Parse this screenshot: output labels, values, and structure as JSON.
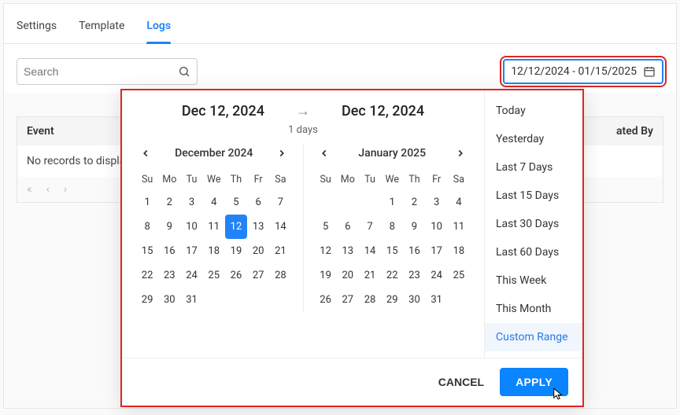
{
  "tabs": {
    "settings": "Settings",
    "template": "Template",
    "logs": "Logs"
  },
  "search": {
    "placeholder": "Search"
  },
  "date_chip": {
    "text": "12/12/2024 - 01/15/2025"
  },
  "table": {
    "headers": {
      "event": "Event",
      "created_by": "ated By"
    },
    "empty": "No records to displa"
  },
  "popup": {
    "start_label": "Dec 12, 2024",
    "end_label": "Dec 12, 2024",
    "days_label": "1 days",
    "months": {
      "left": {
        "title": "December 2024",
        "dows": [
          "Su",
          "Mo",
          "Tu",
          "We",
          "Th",
          "Fr",
          "Sa"
        ],
        "weeks": [
          [
            "1",
            "2",
            "3",
            "4",
            "5",
            "6",
            "7"
          ],
          [
            "8",
            "9",
            "10",
            "11",
            "12",
            "13",
            "14"
          ],
          [
            "15",
            "16",
            "17",
            "18",
            "19",
            "20",
            "21"
          ],
          [
            "22",
            "23",
            "24",
            "25",
            "26",
            "27",
            "28"
          ],
          [
            "29",
            "30",
            "31",
            "",
            "",
            "",
            ""
          ]
        ],
        "selected": [
          "12"
        ]
      },
      "right": {
        "title": "January 2025",
        "dows": [
          "Su",
          "Mo",
          "Tu",
          "We",
          "Th",
          "Fr",
          "Sa"
        ],
        "weeks": [
          [
            "",
            "",
            "",
            "1",
            "2",
            "3",
            "4"
          ],
          [
            "5",
            "6",
            "7",
            "8",
            "9",
            "10",
            "11"
          ],
          [
            "12",
            "13",
            "14",
            "15",
            "16",
            "17",
            "18"
          ],
          [
            "19",
            "20",
            "21",
            "22",
            "23",
            "24",
            "25"
          ],
          [
            "26",
            "27",
            "28",
            "29",
            "30",
            "31",
            ""
          ]
        ],
        "selected": []
      }
    },
    "presets": [
      "Today",
      "Yesterday",
      "Last 7 Days",
      "Last 15 Days",
      "Last 30 Days",
      "Last 60 Days",
      "This Week",
      "This Month",
      "Custom Range"
    ],
    "preset_selected": "Custom Range",
    "cancel": "CANCEL",
    "apply": "APPLY"
  }
}
